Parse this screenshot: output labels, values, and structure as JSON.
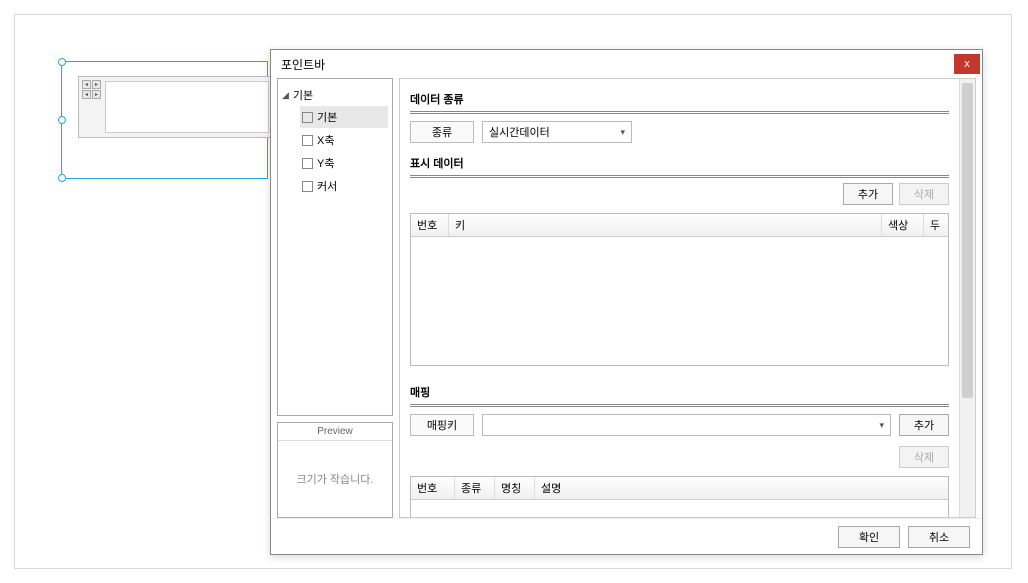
{
  "dialog": {
    "title": "포인트바",
    "close_label": "x",
    "tree": {
      "root": "기본",
      "items": [
        "기본",
        "X축",
        "Y축",
        "커서"
      ]
    },
    "preview": {
      "title": "Preview",
      "message": "크기가 작습니다."
    },
    "sections": {
      "data_type": {
        "title": "데이터 종류",
        "type_label": "종류",
        "type_value": "실시간데이터"
      },
      "display_data": {
        "title": "표시 데이터",
        "add_button": "추가",
        "delete_button": "삭제",
        "columns": {
          "no": "번호",
          "key": "키",
          "color": "색상",
          "extra": "두"
        }
      },
      "mapping": {
        "title": "매핑",
        "key_label": "매핑키",
        "key_value": "",
        "add_button": "추가",
        "delete_button": "삭제",
        "columns": {
          "no": "번호",
          "type": "종류",
          "name": "명칭",
          "desc": "설명"
        }
      }
    },
    "footer": {
      "ok": "확인",
      "cancel": "취소"
    }
  }
}
